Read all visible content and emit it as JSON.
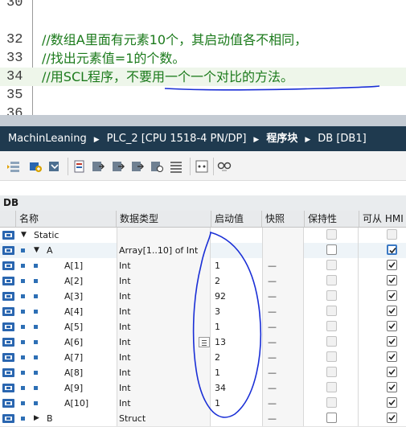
{
  "editor": {
    "lines": [
      {
        "num": "30",
        "code": ""
      },
      {
        "num": "32",
        "code": "//数组A里面有元素10个，其启动值各不相同，"
      },
      {
        "num": "33",
        "code": "//找出元素值=1的个数。"
      },
      {
        "num": "34",
        "code": "//用SCL程序，不要用一个一个对比的方法。"
      },
      {
        "num": "35",
        "code": ""
      },
      {
        "num": "36",
        "code": ""
      }
    ]
  },
  "breadcrumb": {
    "project": "MachinLeaning",
    "device": "PLC_2 [CPU 1518-4 PN/DP]",
    "folder": "程序块",
    "block": "DB [DB1]",
    "separator": "▶"
  },
  "toolbar": {
    "icons": [
      "insert-row-icon",
      "add-row-icon",
      "expand-icon",
      "snapshot-icon",
      "copy-snapshot-icon",
      "load-start-icon",
      "reset-start-icon",
      "monitor-icon",
      "overview-icon",
      "dots-icon",
      "glasses-icon"
    ]
  },
  "db_title": "DB",
  "columns": {
    "name": "名称",
    "type": "数据类型",
    "start": "启动值",
    "snapshot": "快照",
    "retain": "保持性",
    "hmi": "可从 HMI"
  },
  "rows": [
    {
      "name": "Static",
      "type": "",
      "start": "",
      "snapshot": "",
      "level": 0,
      "expand": "down",
      "retain": "none",
      "hmi": "none"
    },
    {
      "name": "A",
      "type": "Array[1..10] of Int",
      "start": "",
      "snapshot": "",
      "level": 1,
      "expand": "down",
      "retain": "empty",
      "hmi": "checked-highlight"
    },
    {
      "name": "A[1]",
      "type": "Int",
      "start": "1",
      "snapshot": "—",
      "level": 2,
      "retain": "none",
      "hmi": "checked"
    },
    {
      "name": "A[2]",
      "type": "Int",
      "start": "2",
      "snapshot": "—",
      "level": 2,
      "retain": "none",
      "hmi": "checked"
    },
    {
      "name": "A[3]",
      "type": "Int",
      "start": "92",
      "snapshot": "—",
      "level": 2,
      "retain": "none",
      "hmi": "checked"
    },
    {
      "name": "A[4]",
      "type": "Int",
      "start": "3",
      "snapshot": "—",
      "level": 2,
      "retain": "none",
      "hmi": "checked"
    },
    {
      "name": "A[5]",
      "type": "Int",
      "start": "1",
      "snapshot": "—",
      "level": 2,
      "retain": "none",
      "hmi": "checked"
    },
    {
      "name": "A[6]",
      "type": "Int",
      "start": "13",
      "snapshot": "—",
      "level": 2,
      "retain": "none",
      "hmi": "checked",
      "list_icon": true
    },
    {
      "name": "A[7]",
      "type": "Int",
      "start": "2",
      "snapshot": "—",
      "level": 2,
      "retain": "none",
      "hmi": "checked"
    },
    {
      "name": "A[8]",
      "type": "Int",
      "start": "1",
      "snapshot": "—",
      "level": 2,
      "retain": "none",
      "hmi": "checked"
    },
    {
      "name": "A[9]",
      "type": "Int",
      "start": "34",
      "snapshot": "—",
      "level": 2,
      "retain": "none",
      "hmi": "checked"
    },
    {
      "name": "A[10]",
      "type": "Int",
      "start": "1",
      "snapshot": "—",
      "level": 2,
      "retain": "none",
      "hmi": "checked"
    },
    {
      "name": "B",
      "type": "Struct",
      "start": "",
      "snapshot": "—",
      "level": 1,
      "expand": "right",
      "retain": "empty",
      "hmi": "checked"
    }
  ],
  "colors": {
    "comment": "#1b7a1b",
    "breadcrumb_bg": "#1f3a4f",
    "annotation": "#1a2fd6",
    "bullet": "#2d6fb5"
  }
}
